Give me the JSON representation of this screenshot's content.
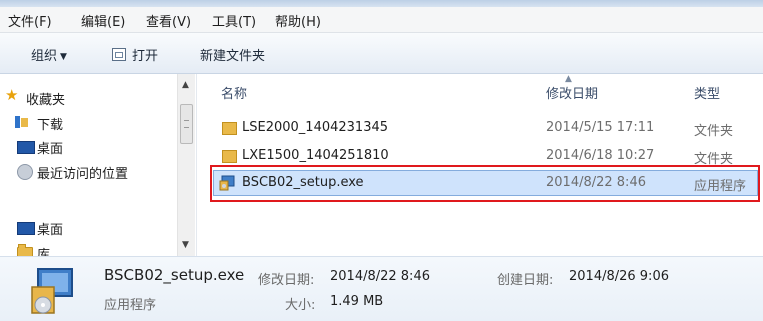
{
  "menu": [
    "文件(F)",
    "编辑(E)",
    "查看(V)",
    "工具(T)",
    "帮助(H)"
  ],
  "toolbar": {
    "organize": "组织",
    "open": "打开",
    "new_folder": "新建文件夹"
  },
  "nav": [
    {
      "label": "收藏夹",
      "icon": "star-icon"
    },
    {
      "label": "下载",
      "icon": "download-icon"
    },
    {
      "label": "桌面",
      "icon": "desktop-icon"
    },
    {
      "label": "最近访问的位置",
      "icon": "recent-places-icon"
    },
    {
      "label": "桌面",
      "icon": "desktop-icon"
    },
    {
      "label": "库",
      "icon": "library-icon"
    }
  ],
  "columns": {
    "name": "名称",
    "modified": "修改日期",
    "type": "类型"
  },
  "files": [
    {
      "name": "LSE2000_1404231345",
      "date": "2014/5/15 17:11",
      "type": "文件夹",
      "icon": "folder-icon"
    },
    {
      "name": "LXE1500_1404251810",
      "date": "2014/6/18 10:27",
      "type": "文件夹",
      "icon": "folder-icon"
    },
    {
      "name": "BSCB02_setup.exe",
      "date": "2014/8/22 8:46",
      "type": "应用程序",
      "icon": "setup-exe-icon"
    }
  ],
  "details": {
    "name": "BSCB02_setup.exe",
    "type": "应用程序",
    "modified_label": "修改日期:",
    "modified": "2014/8/22 8:46",
    "created_label": "创建日期:",
    "created": "2014/8/26 9:06",
    "size_label": "大小:",
    "size": "1.49 MB"
  },
  "colors": {
    "highlight": "#e0191d",
    "selection": "#cfe3fc"
  }
}
